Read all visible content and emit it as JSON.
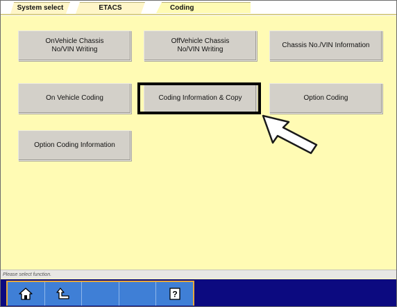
{
  "tabs": [
    {
      "label": "System select"
    },
    {
      "label": "ETACS"
    },
    {
      "label": "Coding"
    }
  ],
  "buttons": [
    {
      "label": "OnVehicle Chassis\nNo/VIN Writing"
    },
    {
      "label": "OffVehicle Chassis\nNo/VIN Writing"
    },
    {
      "label": "Chassis No./VIN Information"
    },
    {
      "label": "On Vehicle Coding"
    },
    {
      "label": "Coding Information & Copy"
    },
    {
      "label": "Option Coding"
    },
    {
      "label": "Option Coding Information"
    }
  ],
  "status": {
    "message": "Please select function."
  },
  "toolbar": {
    "items": [
      {
        "icon": "home-icon"
      },
      {
        "icon": "back-icon"
      },
      {
        "icon": "blank"
      },
      {
        "icon": "blank"
      },
      {
        "icon": "help-icon",
        "label": "?"
      }
    ]
  },
  "colors": {
    "background": "#fffbb4",
    "bottom_bar": "#0c0a80",
    "toolbar": "#3f7fd6",
    "toolbar_border": "#e8a83a"
  }
}
